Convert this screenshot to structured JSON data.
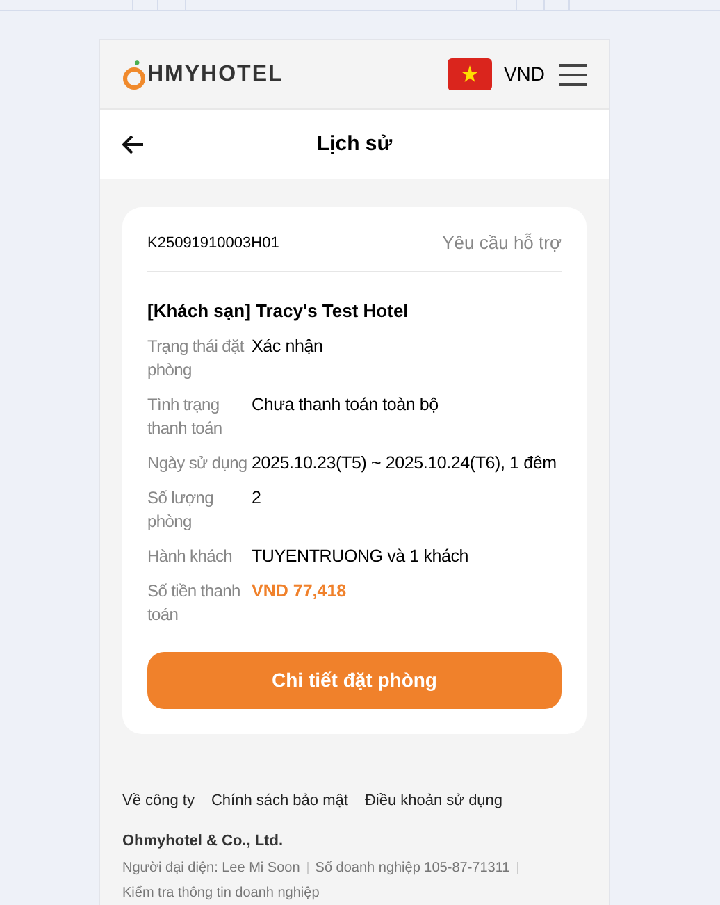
{
  "header": {
    "logo_text": "HMYHOTEL",
    "currency": "VND"
  },
  "title_bar": {
    "title": "Lịch sử"
  },
  "booking": {
    "code": "K25091910003H01",
    "support_link": "Yêu cầu hỗ trợ",
    "hotel": "[Khách sạn] Tracy's Test Hotel",
    "fields": [
      {
        "label": "Trạng thái đặt phòng",
        "value": "Xác nhận",
        "kind": "text"
      },
      {
        "label": "Tình trạng thanh toán",
        "value": "Chưa thanh toán toàn bộ",
        "kind": "text"
      },
      {
        "label": "Ngày sử dụng",
        "value": "2025.10.23(T5) ~ 2025.10.24(T6), 1 đêm",
        "kind": "text"
      },
      {
        "label": "Số lượng phòng",
        "value": "2",
        "kind": "text"
      },
      {
        "label": "Hành khách",
        "value": "TUYENTRUONG và 1 khách",
        "kind": "text"
      },
      {
        "label": "Số tiền thanh toán",
        "value": "VND 77,418",
        "kind": "price"
      }
    ],
    "detail_button": "Chi tiết đặt phòng"
  },
  "footer": {
    "links": [
      "Về công ty",
      "Chính sách bảo mật",
      "Điều khoản sử dụng"
    ],
    "company": "Ohmyhotel & Co., Ltd.",
    "info": [
      "Người đại diện: Lee Mi Soon",
      "Số doanh nghiệp 105-87-71311"
    ],
    "check_link": "Kiểm tra thông tin doanh nghiệp"
  }
}
